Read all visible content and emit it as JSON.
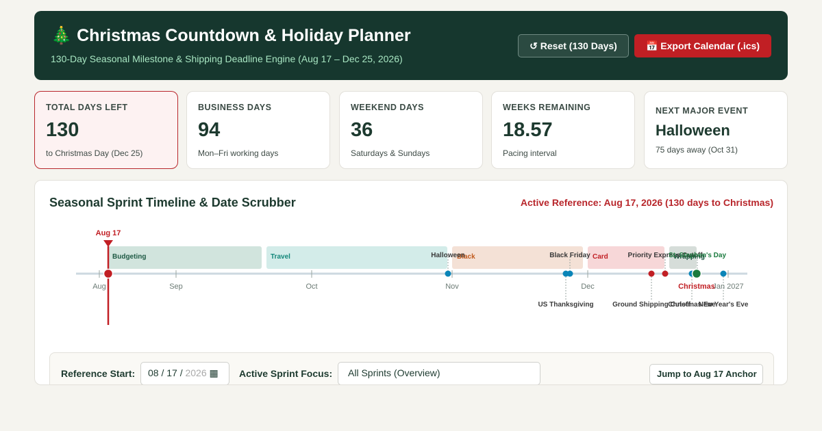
{
  "header": {
    "icon": "christmas-tree-icon",
    "tree_glyph": "🎄",
    "title": "Christmas Countdown & Holiday Planner",
    "subtitle": "130-Day Seasonal Milestone & Shipping Deadline Engine (Aug 17 – Dec 25, 2026)",
    "reset_label": "↺ Reset (130 Days)",
    "export_label": "📅 Export Calendar (.ics)"
  },
  "stats": [
    {
      "label": "TOTAL DAYS LEFT",
      "value": "130",
      "sub": "to Christmas Day (Dec 25)"
    },
    {
      "label": "BUSINESS DAYS",
      "value": "94",
      "sub": "Mon–Fri working days"
    },
    {
      "label": "WEEKEND DAYS",
      "value": "36",
      "sub": "Saturdays & Sundays"
    },
    {
      "label": "WEEKS REMAINING",
      "value": "18.57",
      "sub": "Pacing interval"
    },
    {
      "label": "NEXT MAJOR EVENT",
      "value": "Halloween",
      "sub": "75 days away (Oct 31)"
    }
  ],
  "timeline": {
    "title": "Seasonal Sprint Timeline & Date Scrubber",
    "active_reference": "Active Reference: Aug 17, 2026 (130 days to Christmas)",
    "scrubber_label": "Aug 17",
    "axis_labels": [
      "Aug",
      "Sep",
      "Oct",
      "Nov",
      "Dec",
      "Jan 2027"
    ],
    "sprints": [
      {
        "label": "Budgeting",
        "fill": "#d1e4dd",
        "text": "#1f5a45"
      },
      {
        "label": "Travel",
        "fill": "#d3ece9",
        "text": "#13877a"
      },
      {
        "label": "Black",
        "fill": "#f4e1d6",
        "text": "#c05a1e"
      },
      {
        "label": "Card",
        "fill": "#f7d7d8",
        "text": "#c11f24"
      },
      {
        "label": "Wrapping",
        "fill": "#d6ddd9",
        "text": "#1f5a45"
      }
    ],
    "events": [
      {
        "label": "Halloween",
        "color": "#0a85b8"
      },
      {
        "label": "US Thanksgiving",
        "color": "#0a85b8"
      },
      {
        "label": "Black Friday",
        "color": "#0a85b8"
      },
      {
        "label": "Ground Shipping Cutoff",
        "color": "#c11f24"
      },
      {
        "label": "Priority Express Cutoff",
        "color": "#c11f24"
      },
      {
        "label": "Christmas Eve",
        "color": "#0a85b8"
      },
      {
        "label": "Christmas",
        "color": "#1a7a3e"
      },
      {
        "label": "St. Stephen's Day",
        "color": "#0a85b8"
      },
      {
        "label": "New Year's Eve",
        "color": "#0a85b8"
      }
    ]
  },
  "controls": {
    "reference_label": "Reference Start:",
    "date_value": "08 / 17 /",
    "date_year": "2026",
    "date_icon": "calendar-icon",
    "focus_label": "Active Sprint Focus:",
    "focus_value": "All Sprints (Overview)",
    "jump_label": "Jump to Aug 17 Anchor"
  },
  "colors": {
    "header_bg": "#16372e",
    "accent_red": "#c11f24",
    "accent_green": "#1a7a3e",
    "event_blue": "#0a85b8"
  }
}
